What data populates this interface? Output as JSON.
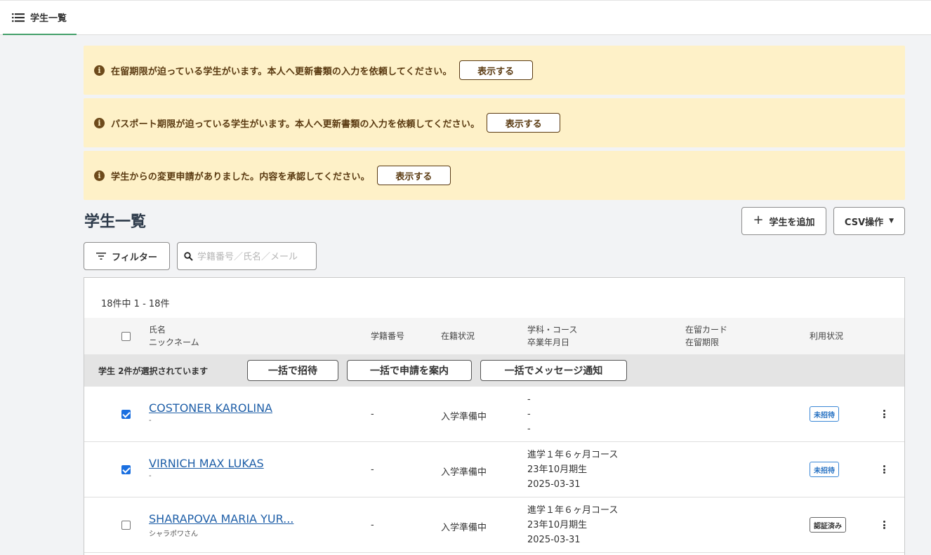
{
  "nav": {
    "tab_label": "学生一覧"
  },
  "alerts": [
    {
      "text": "在留期限が迫っている学生がいます。本人へ更新書類の入力を依頼してください。",
      "button": "表示する"
    },
    {
      "text": "パスポート期限が迫っている学生がいます。本人へ更新書類の入力を依頼してください。",
      "button": "表示する"
    },
    {
      "text": "学生からの変更申請がありました。内容を承認してください。",
      "button": "表示する"
    }
  ],
  "page": {
    "title": "学生一覧",
    "add_button": "学生を追加",
    "csv_button": "CSV操作",
    "filter_button": "フィルター",
    "search_placeholder": "学籍番号／氏名／メール"
  },
  "table": {
    "count_text": "18件中 1 - 18件",
    "headers": {
      "name": "氏名",
      "nickname": "ニックネーム",
      "student_number": "学籍番号",
      "enrollment": "在籍状況",
      "course": "学科・コース",
      "graduation": "卒業年月日",
      "residence_card": "在留カード",
      "residence_deadline": "在留期限",
      "usage": "利用状況"
    },
    "bulk": {
      "selected_text": "学生 2件が選択されています",
      "invite": "一括で招待",
      "apply": "一括で申請を案内",
      "message": "一括でメッセージ通知"
    },
    "rows": [
      {
        "checked": true,
        "name": "COSTONER KAROLINA",
        "nickname": "-",
        "student_number": "-",
        "enrollment": "入学準備中",
        "course": [
          "-",
          "-",
          "-"
        ],
        "usage": "未招待",
        "usage_style": "blue"
      },
      {
        "checked": true,
        "name": "VIRNICH MAX LUKAS",
        "nickname": "-",
        "student_number": "-",
        "enrollment": "入学準備中",
        "course": [
          "進学１年６ヶ月コース",
          "23年10月期生",
          "2025-03-31"
        ],
        "usage": "未招待",
        "usage_style": "blue"
      },
      {
        "checked": false,
        "name": "SHARAPOVA MARIA YUR...",
        "nickname": "シャラポワさん",
        "student_number": "-",
        "enrollment": "入学準備中",
        "course": [
          "進学１年６ヶ月コース",
          "23年10月期生",
          "2025-03-31"
        ],
        "usage": "認証済み",
        "usage_style": "dark"
      }
    ]
  }
}
